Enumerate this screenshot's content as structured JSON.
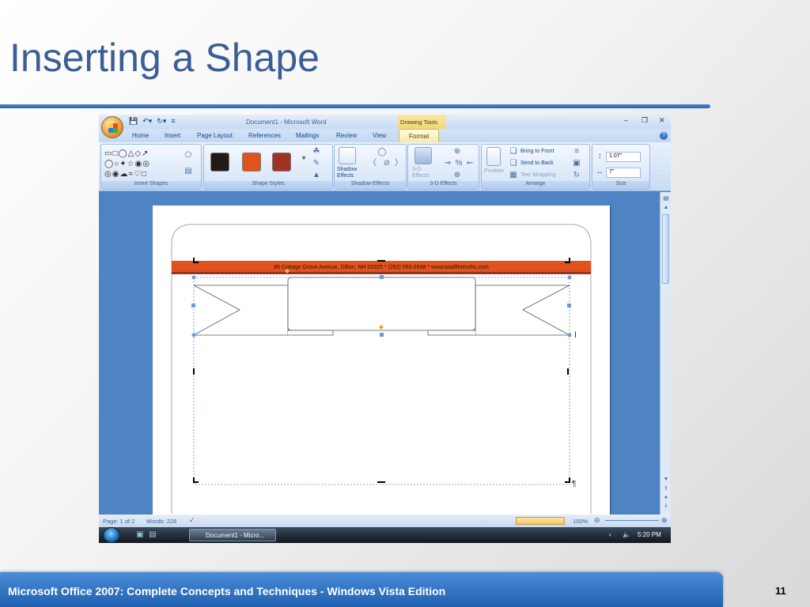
{
  "slide": {
    "title": "Inserting a Shape",
    "footer": "Microsoft Office 2007: Complete Concepts and Techniques - Windows Vista Edition",
    "page_number": "11"
  },
  "word": {
    "doc_title": "Document1 - Microsoft Word",
    "contextual_tab": "Drawing Tools",
    "tabs": [
      "Home",
      "Insert",
      "Page Layout",
      "References",
      "Mailings",
      "Review",
      "View",
      "Format"
    ],
    "active_tab": "Format",
    "groups": {
      "insert_shapes": "Insert Shapes",
      "shape_styles": "Shape Styles",
      "shadow_effects": "Shadow Effects",
      "effects_3d": "3-D Effects",
      "arrange": "Arrange",
      "size": "Size"
    },
    "buttons": {
      "shadow_effects_line1": "Shadow",
      "shadow_effects_line2": "Effects",
      "effects3d_line1": "3-D",
      "effects3d_line2": "Effects",
      "position": "Position",
      "bring_to_front": "Bring to Front",
      "send_to_back": "Send to Back",
      "text_wrapping": "Text Wrapping"
    },
    "size": {
      "height": "1.07\"",
      "width": "7\""
    },
    "swatch_colors": [
      "#231a17",
      "#e0531f",
      "#a13323"
    ],
    "address_line": "85 Cottage Grove Avenue, Dilton, NH 03325 * (262) 555-2838 * www.totalfitnesshc.com",
    "status": {
      "page": "Page: 1 of 2",
      "words": "Words: 228",
      "zoom": "100%"
    },
    "taskbar": {
      "window": "Document1 - Micro...",
      "time": "5:20 PM"
    }
  }
}
